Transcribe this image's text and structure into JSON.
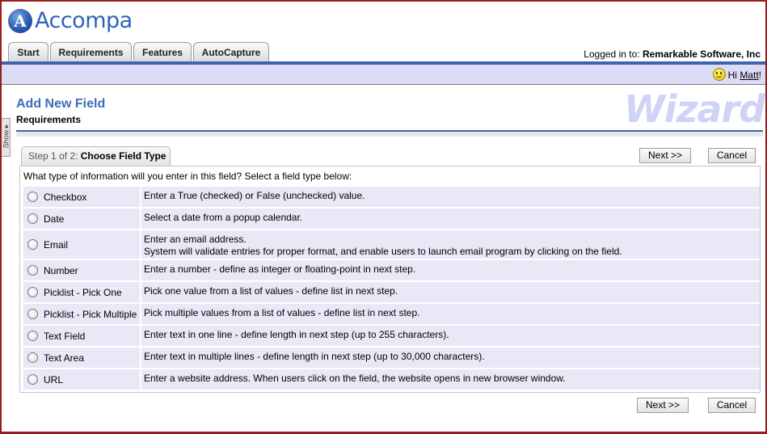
{
  "app": {
    "logo_text": "Accompa",
    "logo_letter": "A"
  },
  "tabs": [
    {
      "label": "Start"
    },
    {
      "label": "Requirements"
    },
    {
      "label": "Features"
    },
    {
      "label": "AutoCapture"
    }
  ],
  "login": {
    "prefix": "Logged in to:",
    "org": "Remarkable Software, Inc"
  },
  "greeting": {
    "prefix": "Hi",
    "user": "Matt",
    "suffix": "!"
  },
  "side_tab": {
    "label": "Show ▸"
  },
  "page": {
    "title": "Add New Field",
    "subtitle": "Requirements",
    "wizard_logo": "Wizard"
  },
  "step": {
    "label": "Step 1 of 2:",
    "value": "Choose Field Type"
  },
  "buttons": {
    "next": "Next >>",
    "cancel": "Cancel"
  },
  "question": "What type of information will you enter in this field? Select a field type below:",
  "field_types": [
    {
      "name": "Checkbox",
      "desc": "Enter a True (checked) or False (unchecked) value."
    },
    {
      "name": "Date",
      "desc": "Select a date from a popup calendar."
    },
    {
      "name": "Email",
      "desc": "Enter an email address.",
      "desc2": "System will validate entries for proper format, and enable users to launch email program by clicking on the field."
    },
    {
      "name": "Number",
      "desc": "Enter a number - define as integer or floating-point in next step."
    },
    {
      "name": "Picklist - Pick One",
      "desc": "Pick one value from a list of values - define list in next step."
    },
    {
      "name": "Picklist - Pick Multiple",
      "desc": "Pick multiple values from a list of values - define list in next step."
    },
    {
      "name": "Text Field",
      "desc": "Enter text in one line - define length in next step (up to 255 characters)."
    },
    {
      "name": "Text Area",
      "desc": "Enter text in multiple lines - define length in next step (up to 30,000 characters)."
    },
    {
      "name": "URL",
      "desc": "Enter a website address. When users click on the field, the website opens in new browser window."
    }
  ]
}
